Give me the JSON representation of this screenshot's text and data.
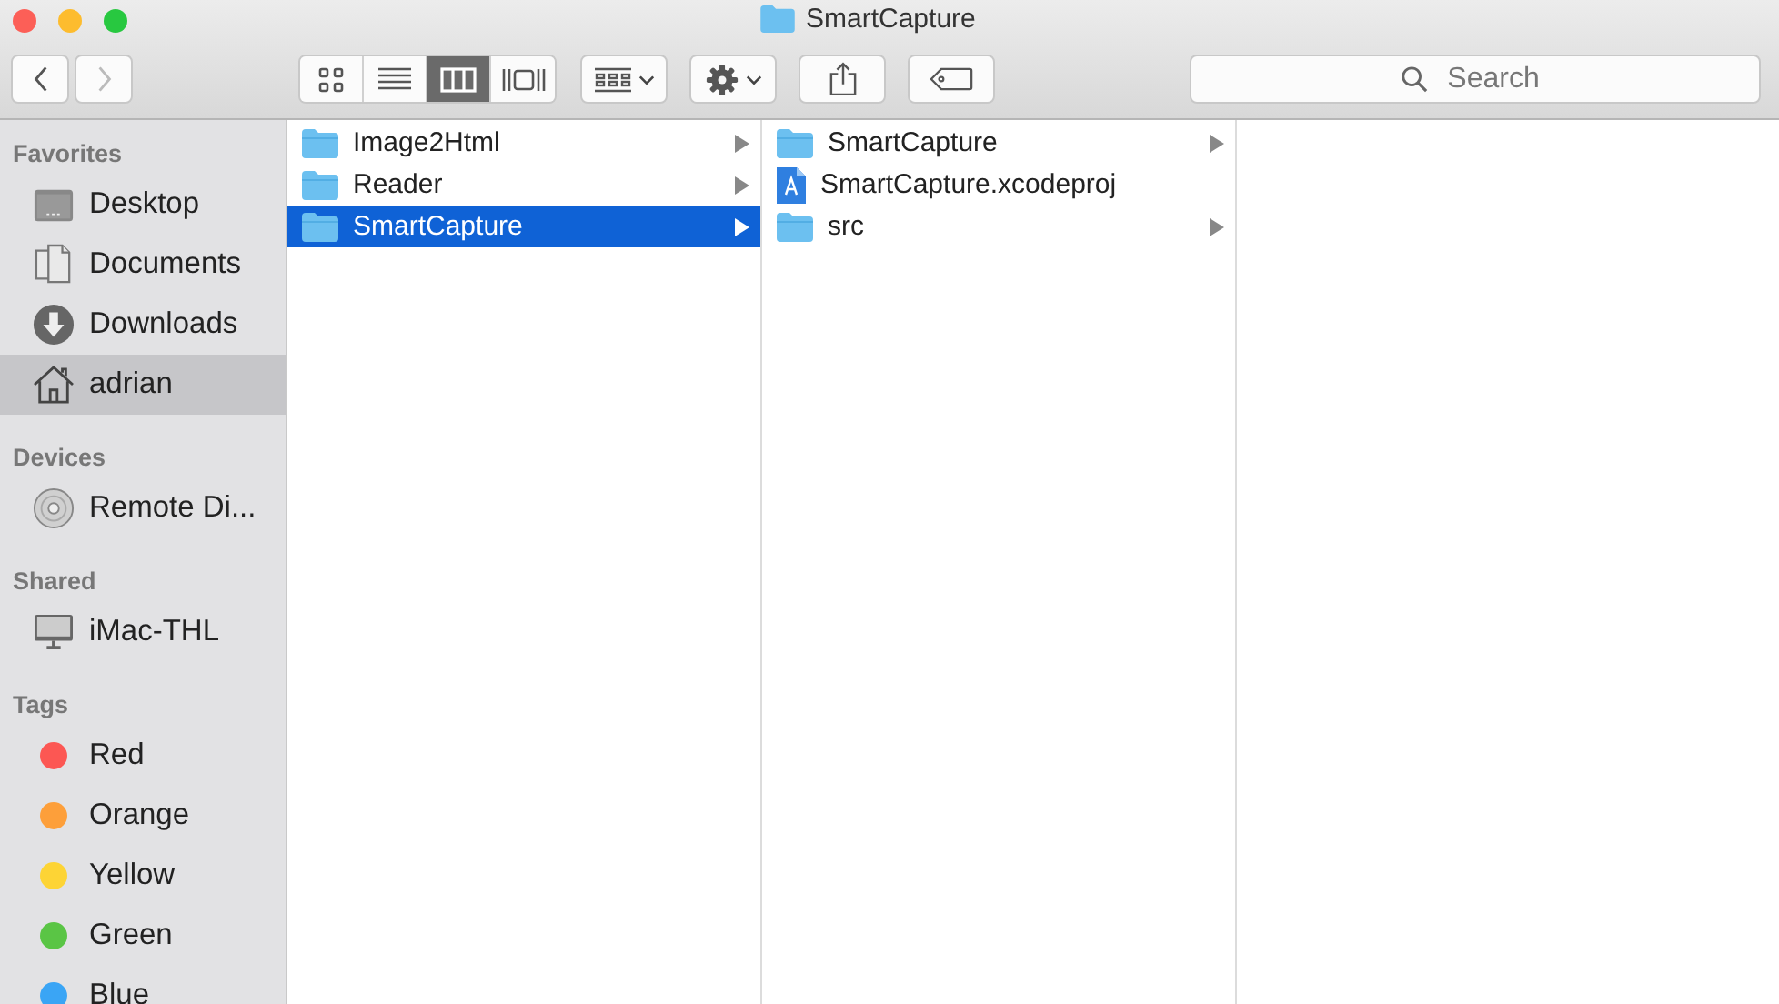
{
  "window": {
    "title": "SmartCapture"
  },
  "toolbar": {
    "view_modes": [
      {
        "kind": "icons",
        "selected": false
      },
      {
        "kind": "list",
        "selected": false
      },
      {
        "kind": "columns",
        "selected": true
      },
      {
        "kind": "gallery",
        "selected": false
      }
    ],
    "search": {
      "placeholder": "Search"
    }
  },
  "sidebar": {
    "sections": [
      {
        "title": "Favorites",
        "items": [
          {
            "label": "Desktop",
            "kind": "desktop",
            "selected": false
          },
          {
            "label": "Documents",
            "kind": "documents",
            "selected": false
          },
          {
            "label": "Downloads",
            "kind": "downloads",
            "selected": false
          },
          {
            "label": "adrian",
            "kind": "home",
            "selected": true
          }
        ]
      },
      {
        "title": "Devices",
        "items": [
          {
            "label": "Remote Di...",
            "kind": "disc",
            "selected": false
          }
        ]
      },
      {
        "title": "Shared",
        "items": [
          {
            "label": "iMac-THL",
            "kind": "computer",
            "selected": false
          }
        ]
      },
      {
        "title": "Tags",
        "items": [
          {
            "label": "Red",
            "kind": "tag",
            "color": "#fc5753",
            "selected": false
          },
          {
            "label": "Orange",
            "kind": "tag",
            "color": "#fd9f3a",
            "selected": false
          },
          {
            "label": "Yellow",
            "kind": "tag",
            "color": "#fdd435",
            "selected": false
          },
          {
            "label": "Green",
            "kind": "tag",
            "color": "#5ac545",
            "selected": false
          },
          {
            "label": "Blue",
            "kind": "tag",
            "color": "#3aa5f5",
            "selected": false
          }
        ]
      }
    ]
  },
  "columns": [
    {
      "items": [
        {
          "name": "Image2Html",
          "kind": "folder",
          "has_children": true,
          "selected": false
        },
        {
          "name": "Reader",
          "kind": "folder",
          "has_children": true,
          "selected": false
        },
        {
          "name": "SmartCapture",
          "kind": "folder",
          "has_children": true,
          "selected": true
        }
      ]
    },
    {
      "items": [
        {
          "name": "SmartCapture",
          "kind": "folder",
          "has_children": true,
          "selected": false
        },
        {
          "name": "SmartCapture.xcodeproj",
          "kind": "project",
          "has_children": false,
          "selected": false
        },
        {
          "name": "src",
          "kind": "folder",
          "has_children": true,
          "selected": false
        }
      ]
    }
  ]
}
